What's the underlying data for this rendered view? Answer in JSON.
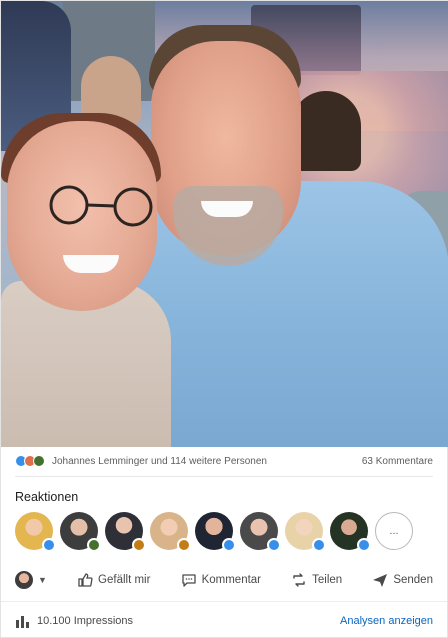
{
  "post": {
    "photo_alt_icon": "selfie-photo"
  },
  "social_counts": {
    "reactions_text": "Johannes Lemminger und 114 weitere Personen",
    "comments_text": "63 Kommentare",
    "reaction_icons": [
      "like-icon",
      "love-icon",
      "celebrate-icon"
    ],
    "reaction_colors": [
      "#378fe9",
      "#df704d",
      "#44712e"
    ]
  },
  "reactions_section": {
    "title": "Reaktionen",
    "more_label": "...",
    "avatars": [
      {
        "name": "reactor-1",
        "bg": "#e3b64f",
        "badge": "#378fe9"
      },
      {
        "name": "reactor-2",
        "bg": "#3d3d3d",
        "badge": "#44712e"
      },
      {
        "name": "reactor-3",
        "bg": "#2f2f38",
        "badge": "#c37d16"
      },
      {
        "name": "reactor-4",
        "bg": "#d9b48a",
        "badge": "#c37d16"
      },
      {
        "name": "reactor-5",
        "bg": "#1f2533",
        "badge": "#378fe9"
      },
      {
        "name": "reactor-6",
        "bg": "#4a4a4a",
        "badge": "#378fe9"
      },
      {
        "name": "reactor-7",
        "bg": "#e8d2a8",
        "badge": "#378fe9"
      },
      {
        "name": "reactor-8",
        "bg": "#253324",
        "badge": "#378fe9"
      }
    ]
  },
  "actions": {
    "like": "Gefällt mir",
    "comment": "Kommentar",
    "share": "Teilen",
    "send": "Senden"
  },
  "footer": {
    "impressions": "10.100 Impressions",
    "analytics_link": "Analysen anzeigen"
  }
}
